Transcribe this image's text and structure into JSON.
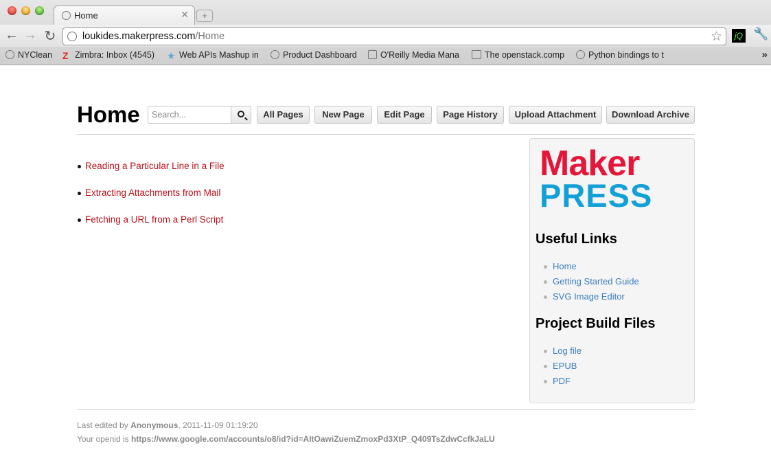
{
  "browser": {
    "tab_title": "Home",
    "tab_close": "✕",
    "newtab_label": "+",
    "nav": {
      "back": "←",
      "forward": "→",
      "reload": "↻"
    },
    "url_host": "loukides.makerpress.com",
    "url_path": "/Home",
    "star": "☆",
    "ext_label": "jQ",
    "wrench": "🔧",
    "bookmarks_more": "»",
    "bookmarks": [
      {
        "label": "NYClean",
        "icon": "globe-icon"
      },
      {
        "label": "Zimbra: Inbox (4545)",
        "icon": "zimbra-icon"
      },
      {
        "label": "Web APIs Mashup in",
        "icon": "star-icon"
      },
      {
        "label": "Product Dashboard",
        "icon": "globe-icon"
      },
      {
        "label": "O'Reilly Media Mana",
        "icon": "gear-icon"
      },
      {
        "label": "The openstack.comp",
        "icon": "document-icon"
      },
      {
        "label": "Python bindings to t",
        "icon": "globe-icon"
      }
    ]
  },
  "header": {
    "title": "Home",
    "search_placeholder": "Search...",
    "buttons": [
      "All Pages",
      "New Page",
      "Edit Page",
      "Page History",
      "Upload Attachment",
      "Download Archive"
    ]
  },
  "content": {
    "links": [
      "Reading a Particular Line in a File",
      "Extracting Attachments from Mail",
      "Fetching a URL from a Perl Script"
    ]
  },
  "sidebar": {
    "logo_line1": "Maker",
    "logo_line2": "PRESS",
    "useful_links_title": "Useful Links",
    "useful_links": [
      "Home",
      "Getting Started Guide",
      "SVG Image Editor"
    ],
    "build_files_title": "Project Build Files",
    "build_files": [
      "Log file",
      "EPUB",
      "PDF"
    ]
  },
  "footer": {
    "edited_prefix": "Last edited by",
    "edited_by": "Anonymous",
    "edited_at": ", 2011-11-09 01:19:20",
    "openid_prefix": "Your openid is",
    "openid": "https://www.google.com/accounts/o8/id?id=AItOawiZuemZmoxPd3XtP_Q409TsZdwCcfkJaLU"
  },
  "colors": {
    "link_red": "#b5121b",
    "link_blue": "#3a7ebf",
    "logo_red": "#e4173a",
    "logo_blue": "#12a0d7"
  }
}
